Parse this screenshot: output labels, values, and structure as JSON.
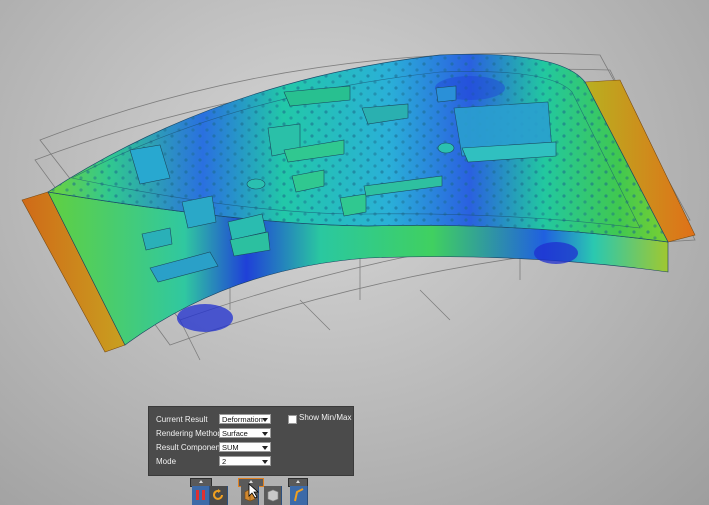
{
  "scene": {
    "description_colors": {
      "background": "#bdbdbd",
      "panel_bg": "#4b4b4b",
      "toolbar_blue": "#3c6aa8",
      "deformation_low": "#1f3fd6",
      "deformation_mid": "#22d070",
      "deformation_high": "#e07018"
    }
  },
  "results_panel": {
    "current_result_label": "Current Result",
    "current_result_value": "Deformation",
    "rendering_method_label": "Rendering Method",
    "rendering_method_value": "Surface",
    "result_component_label": "Result Component",
    "result_component_value": "SUM",
    "mode_label": "Mode",
    "mode_value": "2",
    "show_minmax_label": "Show Min/Max",
    "show_minmax_checked": false
  },
  "toolbar": {
    "buttons": [
      {
        "icon": "pause-icon"
      },
      {
        "icon": "rotate-icon"
      },
      {
        "icon": "part-icon"
      },
      {
        "icon": "box-icon"
      },
      {
        "icon": "probe-icon"
      }
    ]
  }
}
